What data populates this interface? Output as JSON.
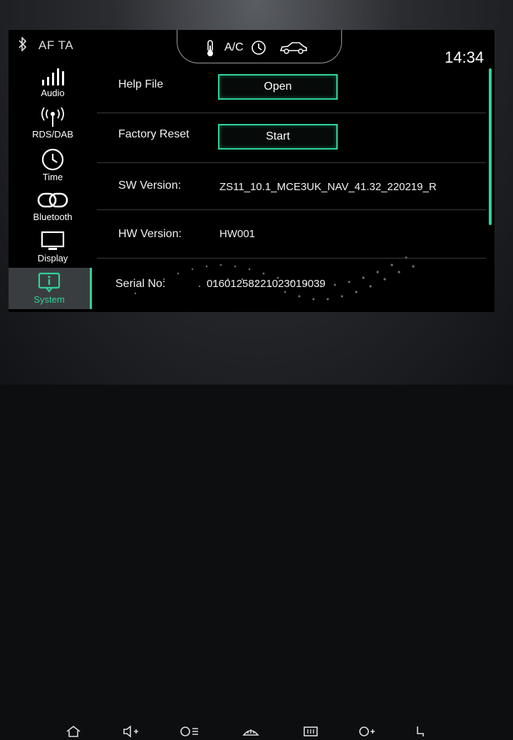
{
  "statusbar": {
    "af_ta": "AF TA",
    "ac_label": "A/C",
    "time": "14:34"
  },
  "sidebar": {
    "items": [
      {
        "label": "Audio",
        "icon": "audio-bars-icon"
      },
      {
        "label": "RDS/DAB",
        "icon": "radio-antenna-icon"
      },
      {
        "label": "Time",
        "icon": "clock-icon"
      },
      {
        "label": "Bluetooth",
        "icon": "link-rings-icon"
      },
      {
        "label": "Display",
        "icon": "monitor-icon"
      },
      {
        "label": "System",
        "icon": "info-screen-icon",
        "active": true
      }
    ]
  },
  "content": {
    "help_file": {
      "label": "Help File",
      "button": "Open"
    },
    "factory_reset": {
      "label": "Factory Reset",
      "button": "Start"
    },
    "sw_version": {
      "label": "SW Version:",
      "value": "ZS11_10.1_MCE3UK_NAV_41.32_220219_R"
    },
    "hw_version": {
      "label": "HW Version:",
      "value": "HW001"
    },
    "serial_no": {
      "label": "Serial No:",
      "value": "01601258221023019039"
    }
  },
  "colors": {
    "accent": "#2fd39a",
    "background": "#000000",
    "text": "#f2f2f2"
  }
}
